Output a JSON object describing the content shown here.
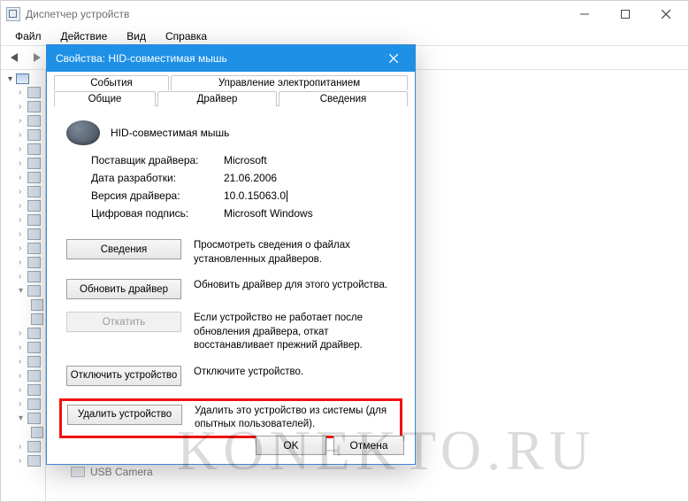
{
  "dm": {
    "title": "Диспетчер устройств",
    "menu": {
      "file": "Файл",
      "action": "Действие",
      "view": "Вид",
      "help": "Справка"
    },
    "usb_camera": "USB Camera"
  },
  "dlg": {
    "title": "Свойства: HID-совместимая мышь",
    "tabs": {
      "events": "События",
      "power": "Управление электропитанием",
      "general": "Общие",
      "driver": "Драйвер",
      "details": "Сведения"
    },
    "device_name": "HID-совместимая мышь",
    "info": {
      "provider_label": "Поставщик драйвера:",
      "provider_val": "Microsoft",
      "date_label": "Дата разработки:",
      "date_val": "21.06.2006",
      "version_label": "Версия драйвера:",
      "version_val": "10.0.15063.0",
      "signer_label": "Цифровая подпись:",
      "signer_val": "Microsoft Windows"
    },
    "actions": {
      "details_btn": "Сведения",
      "details_desc": "Просмотреть сведения о файлах установленных драйверов.",
      "update_btn": "Обновить драйвер",
      "update_desc": "Обновить драйвер для этого устройства.",
      "rollback_btn": "Откатить",
      "rollback_desc": "Если устройство не работает после обновления драйвера, откат восстанавливает прежний драйвер.",
      "disable_btn": "Отключить устройство",
      "disable_desc": "Отключите устройство.",
      "uninstall_btn": "Удалить устройство",
      "uninstall_desc": "Удалить это устройство из системы (для опытных пользователей)."
    },
    "footer": {
      "ok": "OK",
      "cancel": "Отмена"
    }
  },
  "watermark": "KONEKTO.RU"
}
